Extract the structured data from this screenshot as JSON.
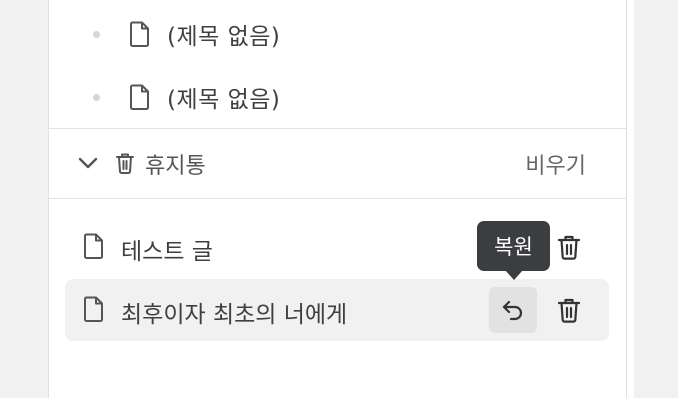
{
  "pages": [
    {
      "label": "(제목 없음)"
    },
    {
      "label": "(제목 없음)"
    }
  ],
  "trash": {
    "title": "휴지통",
    "empty_label": "비우기",
    "items": [
      {
        "label": "테스트 글"
      },
      {
        "label": "최후이자 최초의 너에게"
      }
    ],
    "tooltip": "복원"
  },
  "icons": {
    "document": "document-icon",
    "chevron": "chevron-down-icon",
    "trash": "trash-icon",
    "restore": "undo-icon"
  }
}
